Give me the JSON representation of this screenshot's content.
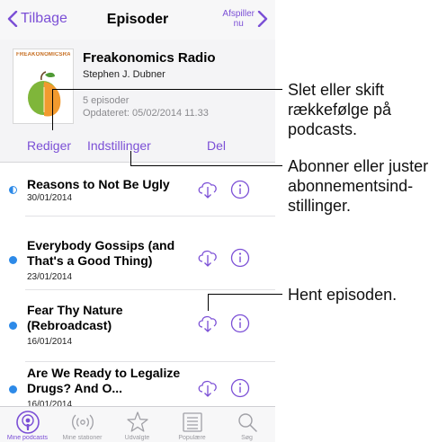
{
  "nav": {
    "back_label": "Tilbage",
    "title": "Episoder",
    "now_playing_line1": "Afspiller",
    "now_playing_line2": "nu"
  },
  "podcast": {
    "artwork_logo_text": "FREAKONOMICSRADIO",
    "title": "Freakonomics Radio",
    "author": "Stephen J. Dubner",
    "episode_count": "5 episoder",
    "updated": "Opdateret: 05/02/2014 11.33"
  },
  "actions": {
    "edit": "Rediger",
    "settings": "Indstillinger",
    "share": "Del"
  },
  "episodes": [
    {
      "title": "Reasons to Not Be Ugly",
      "date": "30/01/2014",
      "played_state": "half"
    },
    {
      "title": "Everybody Gossips (and That's a Good Thing)",
      "date": "23/01/2014",
      "played_state": "unplayed"
    },
    {
      "title": "Fear Thy Nature (Rebroadcast)",
      "date": "16/01/2014",
      "played_state": "unplayed"
    },
    {
      "title": "Are We Ready to Legalize Drugs? And O...",
      "date": "16/01/2014",
      "played_state": "unplayed"
    }
  ],
  "tabs": [
    {
      "label": "Mine podcasts",
      "icon": "podcasts-icon",
      "active": true
    },
    {
      "label": "Mine stationer",
      "icon": "stations-icon",
      "active": false
    },
    {
      "label": "Udvalgte",
      "icon": "star-icon",
      "active": false
    },
    {
      "label": "Populære",
      "icon": "list-icon",
      "active": false
    },
    {
      "label": "Søg",
      "icon": "search-icon",
      "active": false
    }
  ],
  "callouts": {
    "edit": "Slet eller skift rækkefølge på podcasts.",
    "settings": "Abonner eller juster abonnementsind-stillinger.",
    "download": "Hent episoden."
  },
  "colors": {
    "accent": "#7b4fd6",
    "unplayed_dot": "#2d8ae8"
  }
}
